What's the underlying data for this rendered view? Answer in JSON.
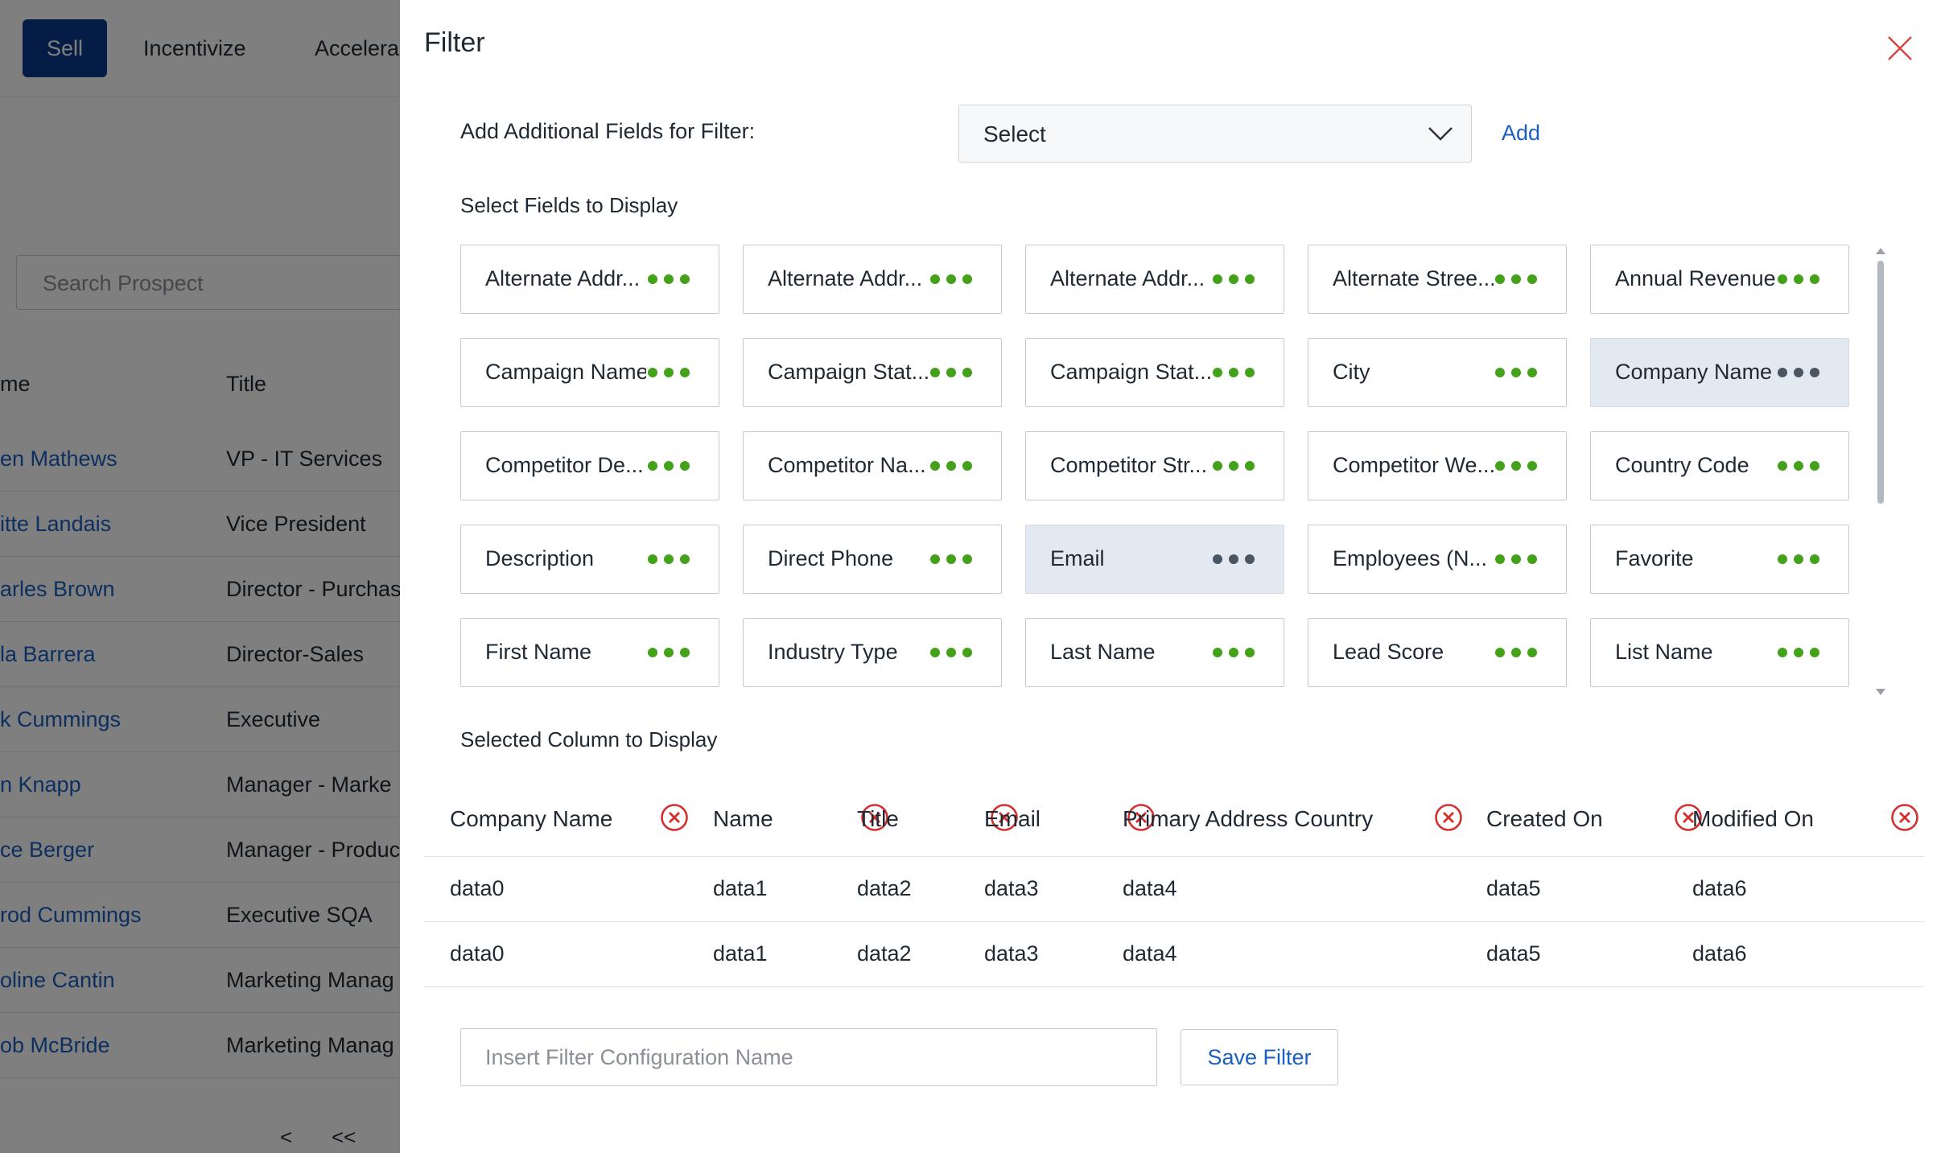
{
  "background_app": {
    "nav": [
      "Sell",
      "Incentivize",
      "Accelera"
    ],
    "search_placeholder": "Search Prospect",
    "table_headers": [
      "me",
      "Title"
    ],
    "rows": [
      {
        "name": "en Mathews",
        "title": "VP - IT Services"
      },
      {
        "name": "itte Landais",
        "title": "Vice President"
      },
      {
        "name": "arles Brown",
        "title": "Director - Purchas"
      },
      {
        "name": "la Barrera",
        "title": "Director-Sales"
      },
      {
        "name": "k Cummings",
        "title": "Executive"
      },
      {
        "name": "n Knapp",
        "title": "Manager - Marke"
      },
      {
        "name": "ce Berger",
        "title": "Manager - Produc"
      },
      {
        "name": "rod Cummings",
        "title": "Executive SQA"
      },
      {
        "name": "oline Cantin",
        "title": "Marketing Manag"
      },
      {
        "name": "ob McBride",
        "title": "Marketing Manag"
      }
    ],
    "pager": [
      "<",
      "<<"
    ]
  },
  "modal": {
    "title": "Filter",
    "add_fields_label": "Add Additional Fields for Filter:",
    "select_value": "Select",
    "add_link": "Add",
    "select_fields_label": "Select Fields to Display",
    "fields": [
      {
        "label": "Alternate Addr...",
        "highlighted": false
      },
      {
        "label": "Alternate Addr...",
        "highlighted": false
      },
      {
        "label": "Alternate Addr...",
        "highlighted": false
      },
      {
        "label": "Alternate Stree...",
        "highlighted": false
      },
      {
        "label": "Annual Revenue",
        "highlighted": false
      },
      {
        "label": "Campaign Name",
        "highlighted": false
      },
      {
        "label": "Campaign Stat...",
        "highlighted": false
      },
      {
        "label": "Campaign Stat...",
        "highlighted": false
      },
      {
        "label": "City",
        "highlighted": false
      },
      {
        "label": "Company Name",
        "highlighted": true
      },
      {
        "label": "Competitor De...",
        "highlighted": false
      },
      {
        "label": "Competitor Na...",
        "highlighted": false
      },
      {
        "label": "Competitor Str...",
        "highlighted": false
      },
      {
        "label": "Competitor We...",
        "highlighted": false
      },
      {
        "label": "Country Code",
        "highlighted": false
      },
      {
        "label": "Description",
        "highlighted": false
      },
      {
        "label": "Direct Phone",
        "highlighted": false
      },
      {
        "label": "Email",
        "highlighted": true
      },
      {
        "label": "Employees (N...",
        "highlighted": false
      },
      {
        "label": "Favorite",
        "highlighted": false
      },
      {
        "label": "First Name",
        "highlighted": false
      },
      {
        "label": "Industry Type",
        "highlighted": false
      },
      {
        "label": "Last Name",
        "highlighted": false
      },
      {
        "label": "Lead Score",
        "highlighted": false
      },
      {
        "label": "List Name",
        "highlighted": false
      }
    ],
    "selected_columns_label": "Selected Column to Display",
    "columns": [
      "Company Name",
      "Name",
      "Title",
      "Email",
      "Primary Address Country",
      "Created On",
      "Modified On"
    ],
    "rows": [
      [
        "data0",
        "data1",
        "data2",
        "data3",
        "data4",
        "data5",
        "data6"
      ],
      [
        "data0",
        "data1",
        "data2",
        "data3",
        "data4",
        "data5",
        "data6"
      ]
    ],
    "filter_name_placeholder": "Insert Filter Configuration Name",
    "save_button": "Save Filter"
  },
  "colors": {
    "accent": "#1b5fc1",
    "nav_active": "#0a3a8c",
    "dots": "#43a11a",
    "remove_icon": "#d32f2f",
    "overlay": "rgba(0,0,0,0.5)"
  }
}
